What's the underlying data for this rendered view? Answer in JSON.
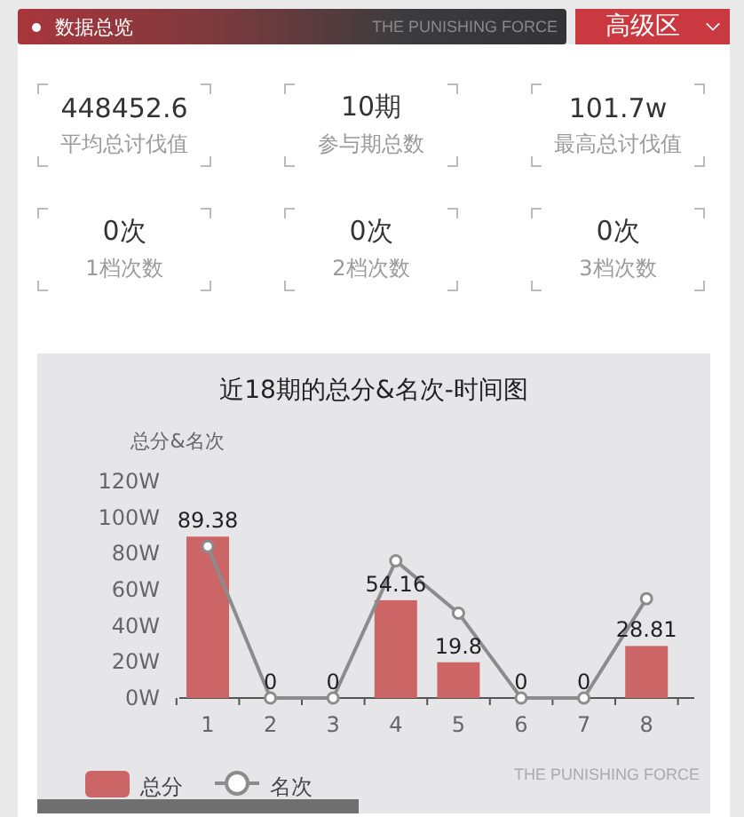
{
  "header": {
    "title": "数据总览",
    "brand": "THE PUNISHING FORCE"
  },
  "zone_select": {
    "value": "高级区"
  },
  "stats": [
    {
      "value": "448452.6",
      "label": "平均总讨伐值"
    },
    {
      "value": "10期",
      "label": "参与期总数"
    },
    {
      "value": "101.7w",
      "label": "最高总讨伐值"
    },
    {
      "value": "0次",
      "label": "1档次数"
    },
    {
      "value": "0次",
      "label": "2档次数"
    },
    {
      "value": "0次",
      "label": "3档次数"
    }
  ],
  "chart": {
    "brand": "THE PUNISHING FORCE",
    "chart_data": {
      "type": "bar",
      "title": "近18期的总分&名次-时间图",
      "ylabel": "总分&名次",
      "legend": true,
      "categories": [
        "1",
        "2",
        "3",
        "4",
        "5",
        "6",
        "7",
        "8"
      ],
      "ylim": [
        0,
        120
      ],
      "yticks": [
        {
          "value": 0,
          "label": "0W"
        },
        {
          "value": 20,
          "label": "20W"
        },
        {
          "value": 40,
          "label": "40W"
        },
        {
          "value": 60,
          "label": "60W"
        },
        {
          "value": 80,
          "label": "80W"
        },
        {
          "value": 100,
          "label": "100W"
        },
        {
          "value": 120,
          "label": "120W"
        }
      ],
      "series": [
        {
          "name": "总分",
          "color": "#cc6666",
          "values": [
            89.38,
            0,
            0,
            54.16,
            19.8,
            0,
            0,
            28.81
          ],
          "value_labels": [
            "89.38",
            "0",
            "0",
            "54.16",
            "19.8",
            "0",
            "0",
            "28.81"
          ]
        },
        {
          "name": "名次",
          "color": "#8c8c8c",
          "type": "line",
          "marker": "circle",
          "values": [
            84,
            0,
            0,
            76,
            47,
            0,
            0,
            55
          ]
        }
      ]
    }
  }
}
